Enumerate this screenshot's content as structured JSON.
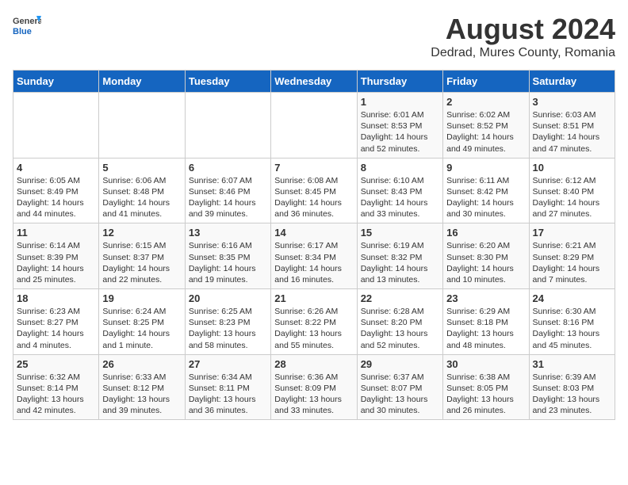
{
  "logo": {
    "general": "General",
    "blue": "Blue"
  },
  "title": "August 2024",
  "subtitle": "Dedrad, Mures County, Romania",
  "days_header": [
    "Sunday",
    "Monday",
    "Tuesday",
    "Wednesday",
    "Thursday",
    "Friday",
    "Saturday"
  ],
  "weeks": [
    [
      {
        "day": "",
        "info": ""
      },
      {
        "day": "",
        "info": ""
      },
      {
        "day": "",
        "info": ""
      },
      {
        "day": "",
        "info": ""
      },
      {
        "day": "1",
        "info": "Sunrise: 6:01 AM\nSunset: 8:53 PM\nDaylight: 14 hours and 52 minutes."
      },
      {
        "day": "2",
        "info": "Sunrise: 6:02 AM\nSunset: 8:52 PM\nDaylight: 14 hours and 49 minutes."
      },
      {
        "day": "3",
        "info": "Sunrise: 6:03 AM\nSunset: 8:51 PM\nDaylight: 14 hours and 47 minutes."
      }
    ],
    [
      {
        "day": "4",
        "info": "Sunrise: 6:05 AM\nSunset: 8:49 PM\nDaylight: 14 hours and 44 minutes."
      },
      {
        "day": "5",
        "info": "Sunrise: 6:06 AM\nSunset: 8:48 PM\nDaylight: 14 hours and 41 minutes."
      },
      {
        "day": "6",
        "info": "Sunrise: 6:07 AM\nSunset: 8:46 PM\nDaylight: 14 hours and 39 minutes."
      },
      {
        "day": "7",
        "info": "Sunrise: 6:08 AM\nSunset: 8:45 PM\nDaylight: 14 hours and 36 minutes."
      },
      {
        "day": "8",
        "info": "Sunrise: 6:10 AM\nSunset: 8:43 PM\nDaylight: 14 hours and 33 minutes."
      },
      {
        "day": "9",
        "info": "Sunrise: 6:11 AM\nSunset: 8:42 PM\nDaylight: 14 hours and 30 minutes."
      },
      {
        "day": "10",
        "info": "Sunrise: 6:12 AM\nSunset: 8:40 PM\nDaylight: 14 hours and 27 minutes."
      }
    ],
    [
      {
        "day": "11",
        "info": "Sunrise: 6:14 AM\nSunset: 8:39 PM\nDaylight: 14 hours and 25 minutes."
      },
      {
        "day": "12",
        "info": "Sunrise: 6:15 AM\nSunset: 8:37 PM\nDaylight: 14 hours and 22 minutes."
      },
      {
        "day": "13",
        "info": "Sunrise: 6:16 AM\nSunset: 8:35 PM\nDaylight: 14 hours and 19 minutes."
      },
      {
        "day": "14",
        "info": "Sunrise: 6:17 AM\nSunset: 8:34 PM\nDaylight: 14 hours and 16 minutes."
      },
      {
        "day": "15",
        "info": "Sunrise: 6:19 AM\nSunset: 8:32 PM\nDaylight: 14 hours and 13 minutes."
      },
      {
        "day": "16",
        "info": "Sunrise: 6:20 AM\nSunset: 8:30 PM\nDaylight: 14 hours and 10 minutes."
      },
      {
        "day": "17",
        "info": "Sunrise: 6:21 AM\nSunset: 8:29 PM\nDaylight: 14 hours and 7 minutes."
      }
    ],
    [
      {
        "day": "18",
        "info": "Sunrise: 6:23 AM\nSunset: 8:27 PM\nDaylight: 14 hours and 4 minutes."
      },
      {
        "day": "19",
        "info": "Sunrise: 6:24 AM\nSunset: 8:25 PM\nDaylight: 14 hours and 1 minute."
      },
      {
        "day": "20",
        "info": "Sunrise: 6:25 AM\nSunset: 8:23 PM\nDaylight: 13 hours and 58 minutes."
      },
      {
        "day": "21",
        "info": "Sunrise: 6:26 AM\nSunset: 8:22 PM\nDaylight: 13 hours and 55 minutes."
      },
      {
        "day": "22",
        "info": "Sunrise: 6:28 AM\nSunset: 8:20 PM\nDaylight: 13 hours and 52 minutes."
      },
      {
        "day": "23",
        "info": "Sunrise: 6:29 AM\nSunset: 8:18 PM\nDaylight: 13 hours and 48 minutes."
      },
      {
        "day": "24",
        "info": "Sunrise: 6:30 AM\nSunset: 8:16 PM\nDaylight: 13 hours and 45 minutes."
      }
    ],
    [
      {
        "day": "25",
        "info": "Sunrise: 6:32 AM\nSunset: 8:14 PM\nDaylight: 13 hours and 42 minutes."
      },
      {
        "day": "26",
        "info": "Sunrise: 6:33 AM\nSunset: 8:12 PM\nDaylight: 13 hours and 39 minutes."
      },
      {
        "day": "27",
        "info": "Sunrise: 6:34 AM\nSunset: 8:11 PM\nDaylight: 13 hours and 36 minutes."
      },
      {
        "day": "28",
        "info": "Sunrise: 6:36 AM\nSunset: 8:09 PM\nDaylight: 13 hours and 33 minutes."
      },
      {
        "day": "29",
        "info": "Sunrise: 6:37 AM\nSunset: 8:07 PM\nDaylight: 13 hours and 30 minutes."
      },
      {
        "day": "30",
        "info": "Sunrise: 6:38 AM\nSunset: 8:05 PM\nDaylight: 13 hours and 26 minutes."
      },
      {
        "day": "31",
        "info": "Sunrise: 6:39 AM\nSunset: 8:03 PM\nDaylight: 13 hours and 23 minutes."
      }
    ]
  ]
}
